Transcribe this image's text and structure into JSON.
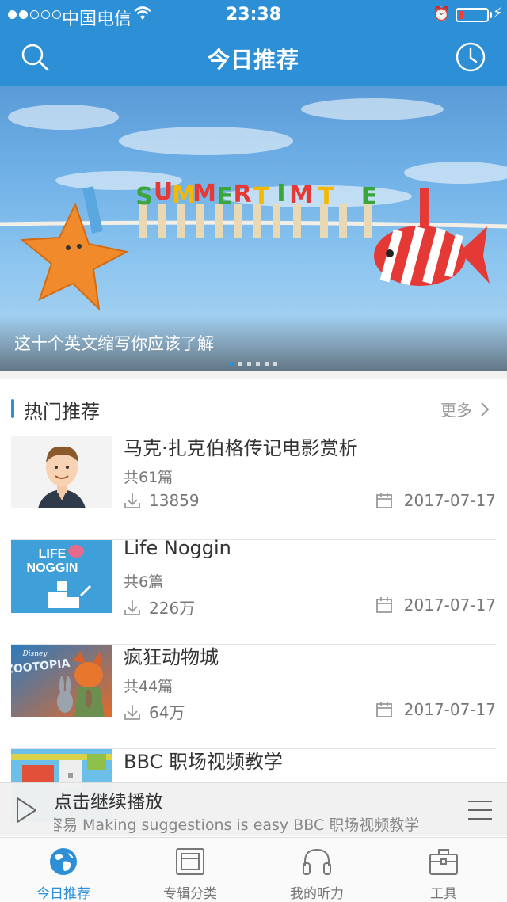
{
  "status_bar": {
    "carrier": "中国电信",
    "time": "23:38",
    "battery_level": 0.12
  },
  "nav": {
    "title": "今日推荐",
    "left_icon": "search-icon",
    "right_icon": "history-clock-icon"
  },
  "banner": {
    "caption": "这十个英文缩写你应该了解",
    "image_text": "SUMMERTIME",
    "page_count": 6,
    "active_page": 1
  },
  "section": {
    "title": "热门推荐",
    "more_label": "更多"
  },
  "items": [
    {
      "title": "马克·扎克伯格传记电影赏析",
      "count": "共61篇",
      "downloads": "13859",
      "date": "2017-07-17",
      "thumb": "zuckerberg-cartoon"
    },
    {
      "title": "Life Noggin",
      "count": "共6篇",
      "downloads": "226万",
      "date": "2017-07-17",
      "thumb": "life-noggin-logo",
      "thumb_text_1": "LIFE",
      "thumb_text_2": "NOGGIN"
    },
    {
      "title": "疯狂动物城",
      "count": "共44篇",
      "downloads": "64万",
      "date": "2017-07-17",
      "thumb": "zootopia-poster",
      "thumb_text": "ZOOTOPIA",
      "thumb_brand": "Disney"
    },
    {
      "title": "BBC 职场视频教学",
      "thumb": "bbc-workplace"
    }
  ],
  "player": {
    "title": "点击继续播放",
    "subtitle": "容易 Making suggestions is easy   BBC 职场视频教学"
  },
  "tabs": [
    {
      "label": "今日推荐",
      "icon": "globe-icon",
      "active": true
    },
    {
      "label": "专辑分类",
      "icon": "album-icon",
      "active": false
    },
    {
      "label": "我的听力",
      "icon": "headphones-icon",
      "active": false
    },
    {
      "label": "工具",
      "icon": "toolbox-icon",
      "active": false
    }
  ],
  "colors": {
    "brand": "#2d8fd5",
    "battery_low": "#ff3b30"
  }
}
